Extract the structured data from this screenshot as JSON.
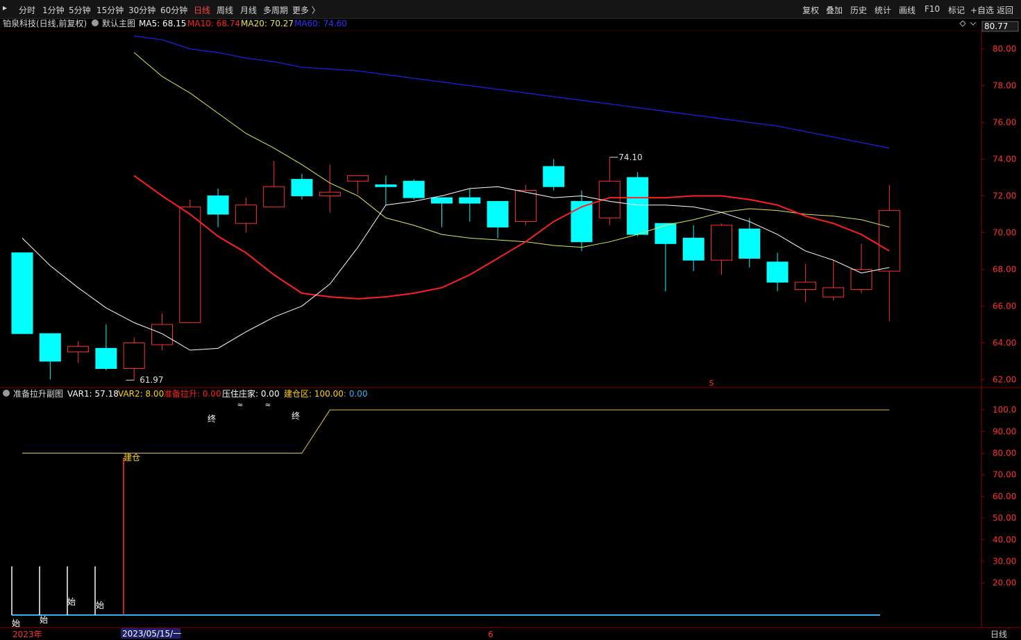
{
  "toolbar": {
    "left": [
      "分时",
      "1分钟",
      "5分钟",
      "15分钟",
      "30分钟",
      "60分钟",
      "日线",
      "周线",
      "月线",
      "多周期",
      "更多 〉"
    ],
    "active": "日线",
    "right": [
      "复权",
      "叠加",
      "历史",
      "统计",
      "画线",
      "F10",
      "标记",
      "+自选",
      "返回"
    ]
  },
  "main_header": {
    "stock": "铂泉科技(日线,前复权)",
    "template": "默认主图",
    "ma5": "MA5: 68.15",
    "ma10": "MA10: 68.74",
    "ma20": "MA20: 70.27",
    "ma60": "MA60: 74.60",
    "top_price": "80.77"
  },
  "sub_header": {
    "name": "准备拉升副图",
    "var1": "VAR1: 57.18",
    "var2": "VAR2: 8.00",
    "prep": "准备拉升: 0.00",
    "press": "压住庄家: 0.00",
    "build": "建仓区: 100.00",
    "extra": ": 0.00"
  },
  "axis": {
    "main_ticks": [
      "80.00",
      "78.00",
      "76.00",
      "74.00",
      "72.00",
      "70.00",
      "68.00",
      "66.00",
      "64.00",
      "62.00"
    ],
    "sub_ticks": [
      "100.0",
      "90.00",
      "80.00",
      "70.00",
      "60.00",
      "50.00",
      "40.00",
      "30.00",
      "20.00"
    ],
    "bottom_left": "2023年",
    "bottom_date": "2023/05/15/一",
    "bottom_mid": "6",
    "bottom_right": "日线"
  },
  "annotations": {
    "high": "74.10",
    "low": "61.97",
    "s_marker": "S",
    "shi": "始",
    "zhong": "终",
    "jiancang": "建仓"
  },
  "colors": {
    "up": "#ff3232",
    "down": "#00ffff",
    "ma5": "#ffffff",
    "ma10": "#ff2020",
    "ma20": "#e6e64c",
    "ma60": "#1e1ee6",
    "grid": "#8b0000",
    "var_line": "#e6c24c"
  },
  "chart_data": {
    "type": "candlestick",
    "ylim": [
      61.6,
      81.0
    ],
    "candles": [
      {
        "o": 68.9,
        "h": 68.9,
        "l": 64.5,
        "c": 64.5
      },
      {
        "o": 64.5,
        "h": 64.5,
        "l": 62.0,
        "c": 63.0
      },
      {
        "o": 63.5,
        "h": 64.1,
        "l": 62.9,
        "c": 63.8
      },
      {
        "o": 63.7,
        "h": 65.0,
        "l": 62.5,
        "c": 62.6
      },
      {
        "o": 62.6,
        "h": 64.3,
        "l": 61.97,
        "c": 64.0
      },
      {
        "o": 63.9,
        "h": 65.6,
        "l": 63.6,
        "c": 65.0
      },
      {
        "o": 65.1,
        "h": 71.8,
        "l": 65.1,
        "c": 71.4
      },
      {
        "o": 72.0,
        "h": 72.4,
        "l": 70.3,
        "c": 71.0
      },
      {
        "o": 70.5,
        "h": 71.9,
        "l": 70.0,
        "c": 71.5
      },
      {
        "o": 71.4,
        "h": 73.9,
        "l": 71.4,
        "c": 72.5
      },
      {
        "o": 72.9,
        "h": 73.2,
        "l": 71.8,
        "c": 72.0
      },
      {
        "o": 72.0,
        "h": 73.7,
        "l": 71.1,
        "c": 72.2
      },
      {
        "o": 72.8,
        "h": 73.1,
        "l": 72.1,
        "c": 73.1
      },
      {
        "o": 72.6,
        "h": 73.1,
        "l": 71.5,
        "c": 72.5
      },
      {
        "o": 72.8,
        "h": 72.9,
        "l": 71.8,
        "c": 71.9
      },
      {
        "o": 71.9,
        "h": 71.9,
        "l": 70.3,
        "c": 71.6
      },
      {
        "o": 71.9,
        "h": 72.4,
        "l": 70.6,
        "c": 71.6
      },
      {
        "o": 71.7,
        "h": 71.7,
        "l": 69.7,
        "c": 70.3
      },
      {
        "o": 70.6,
        "h": 72.6,
        "l": 70.4,
        "c": 72.3
      },
      {
        "o": 73.6,
        "h": 74.0,
        "l": 72.3,
        "c": 72.5
      },
      {
        "o": 71.7,
        "h": 72.3,
        "l": 69.0,
        "c": 69.5
      },
      {
        "o": 70.8,
        "h": 74.1,
        "l": 70.4,
        "c": 72.8
      },
      {
        "o": 73.0,
        "h": 73.3,
        "l": 69.8,
        "c": 69.9
      },
      {
        "o": 70.5,
        "h": 70.5,
        "l": 66.8,
        "c": 69.4
      },
      {
        "o": 69.7,
        "h": 70.4,
        "l": 67.9,
        "c": 68.5
      },
      {
        "o": 68.5,
        "h": 70.5,
        "l": 67.7,
        "c": 70.4
      },
      {
        "o": 70.2,
        "h": 70.8,
        "l": 68.1,
        "c": 68.6
      },
      {
        "o": 68.4,
        "h": 68.9,
        "l": 66.8,
        "c": 67.3
      },
      {
        "o": 66.9,
        "h": 68.3,
        "l": 66.2,
        "c": 67.3
      },
      {
        "o": 66.5,
        "h": 68.5,
        "l": 66.3,
        "c": 67.0
      },
      {
        "o": 66.9,
        "h": 69.4,
        "l": 66.7,
        "c": 68.0
      },
      {
        "o": 67.9,
        "h": 72.6,
        "l": 65.2,
        "c": 71.2
      }
    ],
    "ma5": [
      69.7,
      68.2,
      67.0,
      65.9,
      65.1,
      64.5,
      63.6,
      63.7,
      64.6,
      65.4,
      66.0,
      67.2,
      69.2,
      71.5,
      71.7,
      72.0,
      72.4,
      72.5,
      72.2,
      71.9,
      72.0,
      71.7,
      71.5,
      71.5,
      71.4,
      71.1,
      70.6,
      69.9,
      69.0,
      68.5,
      67.8,
      68.1
    ],
    "ma10": [
      null,
      null,
      null,
      null,
      73.1,
      72.0,
      71.0,
      69.8,
      68.9,
      67.7,
      66.7,
      66.5,
      66.4,
      66.5,
      66.7,
      67.0,
      67.7,
      68.6,
      69.5,
      70.6,
      71.4,
      71.9,
      71.9,
      71.9,
      72.0,
      72.0,
      71.8,
      71.5,
      70.9,
      70.5,
      69.9,
      69.0
    ],
    "ma20": [
      null,
      null,
      null,
      null,
      79.8,
      78.5,
      77.6,
      76.5,
      75.4,
      74.6,
      73.7,
      72.7,
      72.0,
      70.8,
      70.4,
      69.9,
      69.7,
      69.6,
      69.5,
      69.3,
      69.2,
      69.5,
      69.9,
      70.4,
      70.7,
      71.1,
      71.3,
      71.2,
      71.0,
      70.9,
      70.7,
      70.3
    ],
    "ma60": [
      null,
      null,
      null,
      null,
      80.7,
      80.5,
      80.0,
      79.8,
      79.5,
      79.3,
      79.0,
      78.9,
      78.8,
      78.6,
      78.4,
      78.2,
      78.0,
      77.8,
      77.6,
      77.4,
      77.2,
      77.0,
      76.8,
      76.6,
      76.4,
      76.2,
      76.0,
      75.8,
      75.5,
      75.2,
      74.9,
      74.6
    ],
    "var1": [
      80,
      80,
      80,
      80,
      80,
      80,
      80,
      80,
      80,
      80,
      80,
      100,
      100,
      100,
      100,
      100,
      100,
      100,
      100,
      100,
      100,
      100,
      100,
      100,
      100,
      100,
      100,
      100,
      100,
      100,
      100,
      100
    ],
    "sub_ylim": [
      0,
      110
    ]
  }
}
